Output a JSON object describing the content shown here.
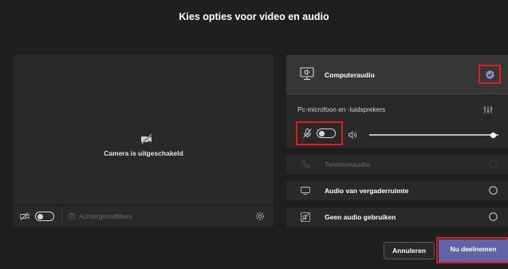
{
  "dialog": {
    "title": "Kies opties voor video en audio"
  },
  "video": {
    "camera_off_text": "Camera is uitgeschakeld",
    "background_filters_label": "Achtergrondfilters"
  },
  "audio": {
    "computer_audio_label": "Computeraudio",
    "device_label": "Pc-microfoon en -luidsprekers",
    "volume_level": 0.96,
    "phone_audio_label": "Telefoonaudio",
    "room_audio_label": "Audio van vergaderruimte",
    "no_audio_label": "Geen audio gebruiken"
  },
  "buttons": {
    "cancel_label": "Annuleren",
    "join_label": "Nu deelnemen"
  },
  "colors": {
    "accent": "#6264a7",
    "highlight": "#e01c1c",
    "background": "#1f1f1f",
    "panel": "#292929"
  }
}
